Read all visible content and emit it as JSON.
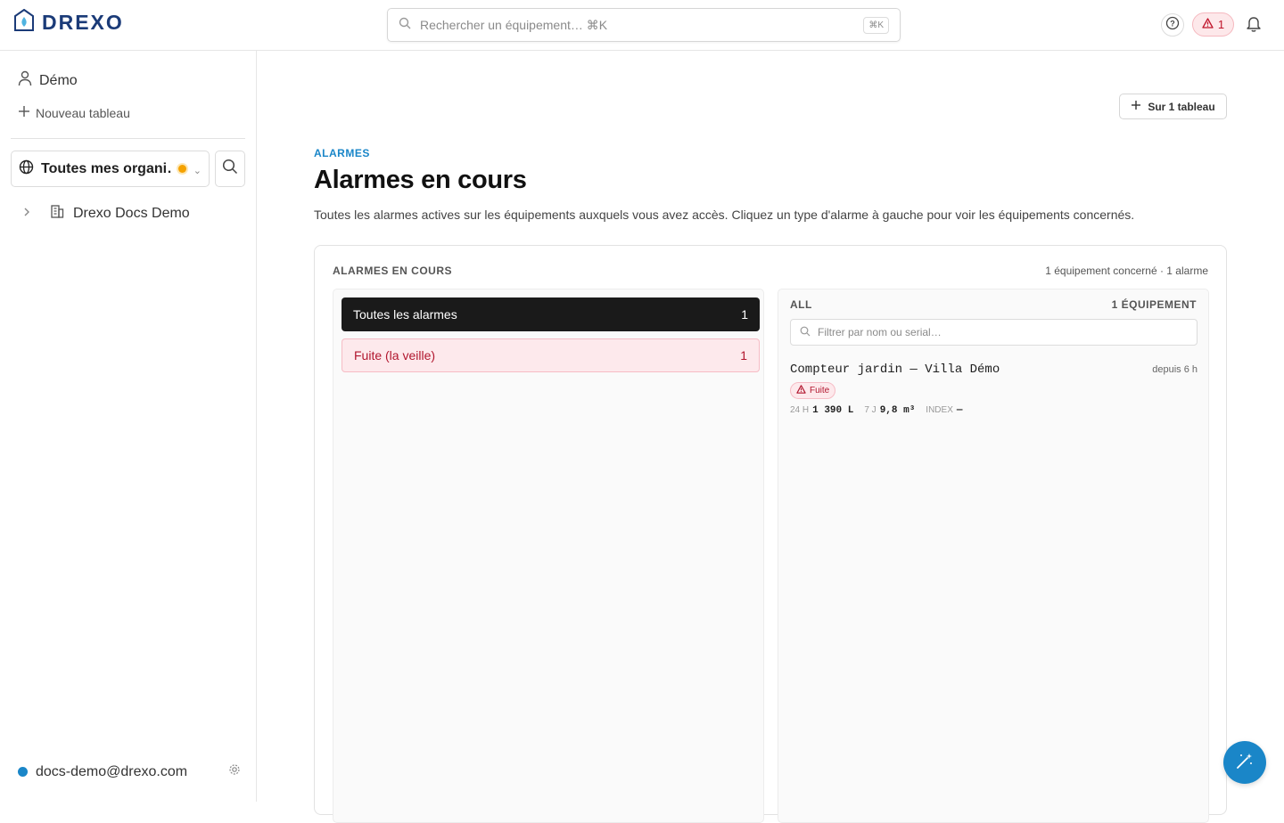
{
  "brand": {
    "name": "DREXO",
    "color": "#1b3b78",
    "accent": "#1a86c8"
  },
  "header": {
    "search_placeholder": "Rechercher un équipement… ⌘K",
    "search_shortcut": "⌘K",
    "alarm_count": "1",
    "icons": [
      "search-icon",
      "help-icon",
      "alert-triangle-icon",
      "bell-icon"
    ]
  },
  "sidebar": {
    "user": "Démo",
    "new_board": "Nouveau tableau",
    "org_select": "Toutes mes organi…",
    "org_status_color": "#f5a200",
    "tree": [
      {
        "label": "Drexo Docs Demo"
      }
    ],
    "account_email": "docs-demo@drexo.com"
  },
  "main": {
    "top_button": "Sur 1 tableau",
    "eyebrow": "ALARMES",
    "title": "Alarmes en cours",
    "description": "Toutes les alarmes actives sur les équipements auxquels vous avez accès. Cliquez un type d'alarme à gauche pour voir les équipements concernés."
  },
  "card": {
    "title": "ALARMES EN COURS",
    "meta": "1 équipement concerné · 1 alarme",
    "types": [
      {
        "label": "Toutes les alarmes",
        "count": "1"
      },
      {
        "label": "Fuite (la veille)",
        "count": "1"
      }
    ],
    "right": {
      "heading": "ALL",
      "count_label": "1 ÉQUIPEMENT",
      "filter_placeholder": "Filtrer par nom ou serial…",
      "device": {
        "name": "Compteur jardin — Villa Démo",
        "since": "depuis 6 h",
        "badge": "Fuite",
        "stats": [
          {
            "label": "24 H",
            "value": "1 390 L"
          },
          {
            "label": "7 J",
            "value": "9,8 m³"
          },
          {
            "label": "INDEX",
            "value": "—"
          }
        ]
      }
    }
  }
}
